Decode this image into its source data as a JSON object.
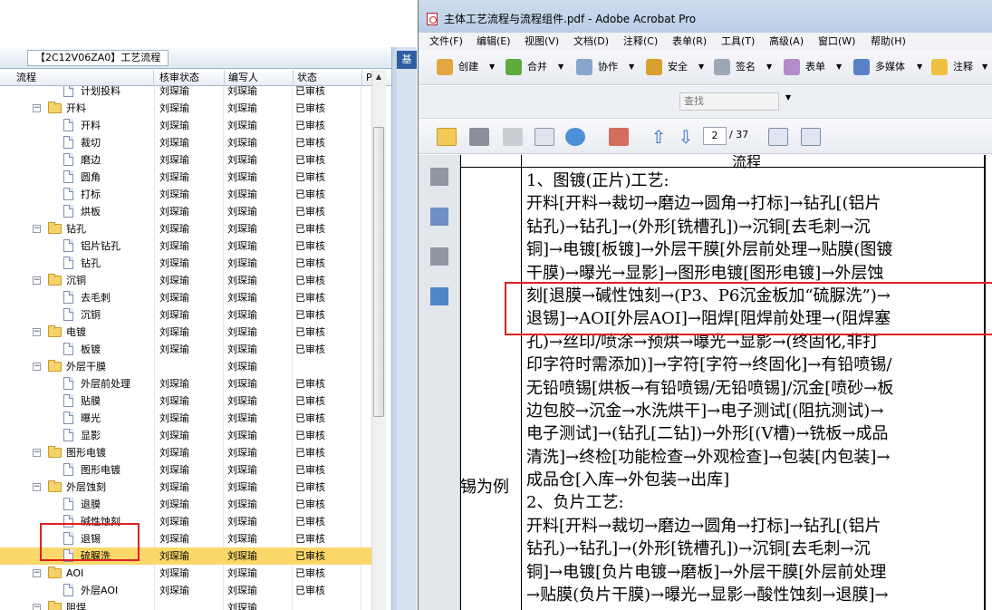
{
  "left_panel": {
    "tab_title": "【2C12V06ZA0】工艺流程",
    "side_tab": "基",
    "columns": [
      "流程",
      "核审状态",
      "编写人",
      "状态",
      "P"
    ],
    "rows": [
      {
        "name": "计划投料",
        "reviewer": "刘琛瑜",
        "author": "刘琛瑜",
        "status": "已审核",
        "level": 2,
        "type": "doc",
        "clipped": true
      },
      {
        "name": "开料",
        "reviewer": "刘琛瑜",
        "author": "刘琛瑜",
        "status": "已审核",
        "level": 1,
        "type": "folder"
      },
      {
        "name": "开料",
        "reviewer": "刘琛瑜",
        "author": "刘琛瑜",
        "status": "已审核",
        "level": 2,
        "type": "doc"
      },
      {
        "name": "裁切",
        "reviewer": "刘琛瑜",
        "author": "刘琛瑜",
        "status": "已审核",
        "level": 2,
        "type": "doc"
      },
      {
        "name": "磨边",
        "reviewer": "刘琛瑜",
        "author": "刘琛瑜",
        "status": "已审核",
        "level": 2,
        "type": "doc"
      },
      {
        "name": "圆角",
        "reviewer": "刘琛瑜",
        "author": "刘琛瑜",
        "status": "已审核",
        "level": 2,
        "type": "doc"
      },
      {
        "name": "打标",
        "reviewer": "刘琛瑜",
        "author": "刘琛瑜",
        "status": "已审核",
        "level": 2,
        "type": "doc"
      },
      {
        "name": "烘板",
        "reviewer": "刘琛瑜",
        "author": "刘琛瑜",
        "status": "已审核",
        "level": 2,
        "type": "doc"
      },
      {
        "name": "钻孔",
        "reviewer": "刘琛瑜",
        "author": "刘琛瑜",
        "status": "已审核",
        "level": 1,
        "type": "folder"
      },
      {
        "name": "铝片钻孔",
        "reviewer": "刘琛瑜",
        "author": "刘琛瑜",
        "status": "已审核",
        "level": 2,
        "type": "doc"
      },
      {
        "name": "钻孔",
        "reviewer": "刘琛瑜",
        "author": "刘琛瑜",
        "status": "已审核",
        "level": 2,
        "type": "doc"
      },
      {
        "name": "沉铜",
        "reviewer": "刘琛瑜",
        "author": "刘琛瑜",
        "status": "已审核",
        "level": 1,
        "type": "folder"
      },
      {
        "name": "去毛刺",
        "reviewer": "刘琛瑜",
        "author": "刘琛瑜",
        "status": "已审核",
        "level": 2,
        "type": "doc"
      },
      {
        "name": "沉铜",
        "reviewer": "刘琛瑜",
        "author": "刘琛瑜",
        "status": "已审核",
        "level": 2,
        "type": "doc"
      },
      {
        "name": "电镀",
        "reviewer": "刘琛瑜",
        "author": "刘琛瑜",
        "status": "已审核",
        "level": 1,
        "type": "folder"
      },
      {
        "name": "板镀",
        "reviewer": "刘琛瑜",
        "author": "刘琛瑜",
        "status": "已审核",
        "level": 2,
        "type": "doc"
      },
      {
        "name": "外层干膜",
        "reviewer": "",
        "author": "刘琛瑜",
        "status": "",
        "level": 1,
        "type": "folder"
      },
      {
        "name": "外层前处理",
        "reviewer": "刘琛瑜",
        "author": "刘琛瑜",
        "status": "已审核",
        "level": 2,
        "type": "doc"
      },
      {
        "name": "贴膜",
        "reviewer": "刘琛瑜",
        "author": "刘琛瑜",
        "status": "已审核",
        "level": 2,
        "type": "doc"
      },
      {
        "name": "曝光",
        "reviewer": "刘琛瑜",
        "author": "刘琛瑜",
        "status": "已审核",
        "level": 2,
        "type": "doc"
      },
      {
        "name": "显影",
        "reviewer": "刘琛瑜",
        "author": "刘琛瑜",
        "status": "已审核",
        "level": 2,
        "type": "doc"
      },
      {
        "name": "图形电镀",
        "reviewer": "刘琛瑜",
        "author": "刘琛瑜",
        "status": "已审核",
        "level": 1,
        "type": "folder"
      },
      {
        "name": "图形电镀",
        "reviewer": "刘琛瑜",
        "author": "刘琛瑜",
        "status": "已审核",
        "level": 2,
        "type": "doc"
      },
      {
        "name": "外层蚀刻",
        "reviewer": "刘琛瑜",
        "author": "刘琛瑜",
        "status": "已审核",
        "level": 1,
        "type": "folder"
      },
      {
        "name": "退膜",
        "reviewer": "刘琛瑜",
        "author": "刘琛瑜",
        "status": "已审核",
        "level": 2,
        "type": "doc"
      },
      {
        "name": "碱性蚀刻",
        "reviewer": "刘琛瑜",
        "author": "刘琛瑜",
        "status": "已审核",
        "level": 2,
        "type": "doc"
      },
      {
        "name": "退锡",
        "reviewer": "刘琛瑜",
        "author": "刘琛瑜",
        "status": "已审核",
        "level": 2,
        "type": "doc"
      },
      {
        "name": "硫脲洗",
        "reviewer": "刘琛瑜",
        "author": "刘琛瑜",
        "status": "已审核",
        "level": 2,
        "type": "doc",
        "selected": true
      },
      {
        "name": "AOI",
        "reviewer": "刘琛瑜",
        "author": "刘琛瑜",
        "status": "已审核",
        "level": 1,
        "type": "folder"
      },
      {
        "name": "外层AOI",
        "reviewer": "刘琛瑜",
        "author": "刘琛瑜",
        "status": "已审核",
        "level": 2,
        "type": "doc"
      },
      {
        "name": "阻焊",
        "reviewer": "",
        "author": "刘琛瑜",
        "status": "",
        "level": 1,
        "type": "folder"
      }
    ]
  },
  "acrobat": {
    "title": "主体工艺流程与流程组件.pdf - Adobe Acrobat Pro",
    "menu": [
      "文件(F)",
      "编辑(E)",
      "视图(V)",
      "文档(D)",
      "注释(C)",
      "表单(R)",
      "工具(T)",
      "高级(A)",
      "窗口(W)",
      "帮助(H)"
    ],
    "toolbar": [
      {
        "label": "创建",
        "icon": "create-icon"
      },
      {
        "label": "合并",
        "icon": "combine-icon"
      },
      {
        "label": "协作",
        "icon": "collaborate-icon"
      },
      {
        "label": "安全",
        "icon": "lock-icon"
      },
      {
        "label": "签名",
        "icon": "pen-icon"
      },
      {
        "label": "表单",
        "icon": "form-icon"
      },
      {
        "label": "多媒体",
        "icon": "multimedia-icon"
      },
      {
        "label": "注释",
        "icon": "comment-icon"
      }
    ],
    "search_placeholder": "查找",
    "page_current": "2",
    "page_total": "/ 37",
    "doc": {
      "header": "流程",
      "left_label": "锡为例",
      "lines": [
        "1、图镀(正片)工艺:",
        "开料[开料→裁切→磨边→圆角→打标]→钻孔[(铝片",
        "钻孔)→钻孔]→(外形[铣槽孔])→沉铜[去毛刺→沉",
        "铜]→电镀[板镀]→外层干膜[外层前处理→贴膜(图镀",
        "干膜)→曝光→显影]→图形电镀[图形电镀]→外层蚀",
        "刻[退膜→碱性蚀刻→(P3、P6沉金板加“硫脲洗”)→",
        "退锡]→AOI[外层AOI]→阻焊[阻焊前处理→(阻焊塞",
        "孔)→丝印/喷涂→预烘→曝光→显影→(终固化,非打",
        "印字符时需添加)]→字符[字符→终固化]→有铅喷锡/",
        "无铅喷锡[烘板→有铅喷锡/无铅喷锡]/沉金[喷砂→板",
        "边包胶→沉金→水洗烘干]→电子测试[(阻抗测试)→",
        "电子测试]→(钻孔[二钻])→外形[(V槽)→铣板→成品",
        "清洗]→终检[功能检查→外观检查]→包装[内包装]→",
        "成品仓[入库→外包装→出库]",
        "2、负片工艺:",
        "开料[开料→裁切→磨边→圆角→打标]→钻孔[(铝片",
        "钻孔)→钻孔]→(外形[铣槽孔])→沉铜[去毛刺→沉",
        "铜]→电镀[负片电镀→磨板]→外层干膜[外层前处理",
        "→贴膜(负片干膜)→曝光→显影→酸性蚀刻→退膜]→"
      ]
    }
  }
}
